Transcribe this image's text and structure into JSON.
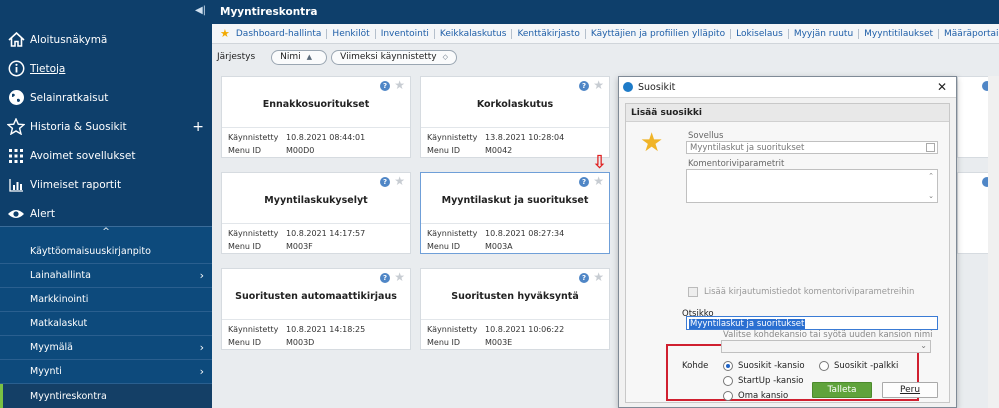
{
  "sidebar": {
    "main": [
      {
        "label": "Aloitusnäkymä",
        "icon": "home-icon"
      },
      {
        "label": "Tietoja",
        "icon": "info-icon"
      },
      {
        "label": "Selainratkaisut",
        "icon": "globe-icon"
      },
      {
        "label": "Historia & Suosikit",
        "icon": "star-icon",
        "extra": "+"
      },
      {
        "label": "Avoimet sovellukset",
        "icon": "grid-icon"
      },
      {
        "label": "Viimeiset raportit",
        "icon": "chart-icon"
      },
      {
        "label": "Alert",
        "icon": "eye-icon"
      }
    ],
    "sub": [
      {
        "label": "Käyttöomaisuuskirjanpito"
      },
      {
        "label": "Lainahallinta",
        "chevron": "›"
      },
      {
        "label": "Markkinointi"
      },
      {
        "label": "Matkalaskut"
      },
      {
        "label": "Myymälä",
        "chevron": "›"
      },
      {
        "label": "Myynti",
        "chevron": "›"
      },
      {
        "label": "Myyntireskontra"
      }
    ]
  },
  "header": {
    "title": "Myyntireskontra"
  },
  "links": [
    "Dashboard-hallinta",
    "Henkilöt",
    "Inventointi",
    "Keikkalaskutus",
    "Kenttäkirjasto",
    "Käyttäjien ja profiilien ylläpito",
    "Lokiselaus",
    "Myyjän ruutu",
    "Myyntitilaukset",
    "Määräportainen sopimushinnasto"
  ],
  "sort": {
    "label": "Järjestys",
    "name": "Nimi",
    "last": "Viimeksi käynnistetty"
  },
  "cards": [
    {
      "title": "Ennakkosuoritukset",
      "started_label": "Käynnistetty",
      "started": "10.8.2021 08:44:01",
      "menu_label": "Menu ID",
      "menu": "M00D0"
    },
    {
      "title": "Korkolaskutus",
      "started_label": "Käynnistetty",
      "started": "13.8.2021 10:28:04",
      "menu_label": "Menu ID",
      "menu": "M0042"
    },
    {
      "title": "Myyntilaskukyselyt",
      "started_label": "Käynnistetty",
      "started": "10.8.2021 14:17:57",
      "menu_label": "Menu ID",
      "menu": "M003F"
    },
    {
      "title": "Myyntilaskut ja suoritukset",
      "started_label": "Käynnistetty",
      "started": "10.8.2021 08:27:34",
      "menu_label": "Menu ID",
      "menu": "M003A"
    },
    {
      "title": "Suoritusten automaattikirjaus",
      "started_label": "Käynnistetty",
      "started": "10.8.2021 14:18:25",
      "menu_label": "Menu ID",
      "menu": "M003D"
    },
    {
      "title": "Suoritusten hyväksyntä",
      "started_label": "Käynnistetty",
      "started": "10.8.2021 10:06:22",
      "menu_label": "Menu ID",
      "menu": "M003E"
    }
  ],
  "dialog": {
    "title": "Suosikit",
    "section": "Lisää suosikki",
    "app_label": "Sovellus",
    "app_value": "Myyntilaskut ja suoritukset",
    "cmd_label": "Komentoriviparametrit",
    "login_check": "Lisää kirjautumistiedot komentoriviparametreihin",
    "title_label": "Otsikko",
    "title_value": "Myyntilaskut ja suoritukset",
    "target_label": "Kohde",
    "opt_folder": "Suosikit -kansio",
    "opt_bar": "Suosikit -palkki",
    "opt_startup": "StartUp -kansio",
    "opt_own": "Oma kansio",
    "folder_placeholder": "Valitse kohdekansio tai syötä uuden kansion nimi",
    "save": "Talleta",
    "cancel": "Peru"
  },
  "colors": {
    "sidebar": "#0e3f6b",
    "save": "#5fa33b",
    "highlight": "#d02030"
  }
}
